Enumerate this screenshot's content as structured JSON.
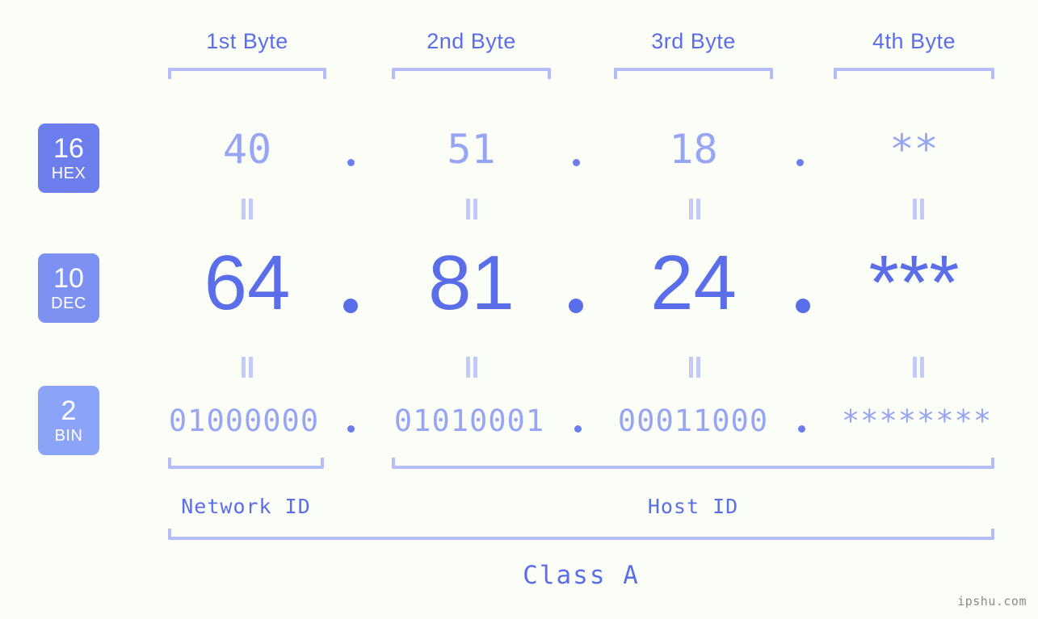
{
  "meta": {
    "background": "#fbfdf7",
    "accent_strong": "#5b6ee9",
    "accent_light": "#97a6f4",
    "bracket_color": "#b4bdf7",
    "watermark": "ipshu.com"
  },
  "byte_headers": [
    {
      "label": "1st Byte"
    },
    {
      "label": "2nd Byte"
    },
    {
      "label": "3rd Byte"
    },
    {
      "label": "4th Byte"
    }
  ],
  "bases": [
    {
      "num": "16",
      "abbr": "HEX",
      "color": "#6b7eec"
    },
    {
      "num": "10",
      "abbr": "DEC",
      "color": "#7d91f3"
    },
    {
      "num": "2",
      "abbr": "BIN",
      "color": "#8ca4f8"
    }
  ],
  "rows": {
    "hex": {
      "values": [
        "40",
        "51",
        "18",
        "**"
      ],
      "separator": "."
    },
    "dec": {
      "values": [
        "64",
        "81",
        "24",
        "***"
      ],
      "separator": "."
    },
    "bin": {
      "values": [
        "01000000",
        "01010001",
        "00011000",
        "********"
      ],
      "separator": "."
    }
  },
  "equality_symbol": "||",
  "segments": {
    "network_id": "Network ID",
    "host_id": "Host ID"
  },
  "class_label": "Class A"
}
